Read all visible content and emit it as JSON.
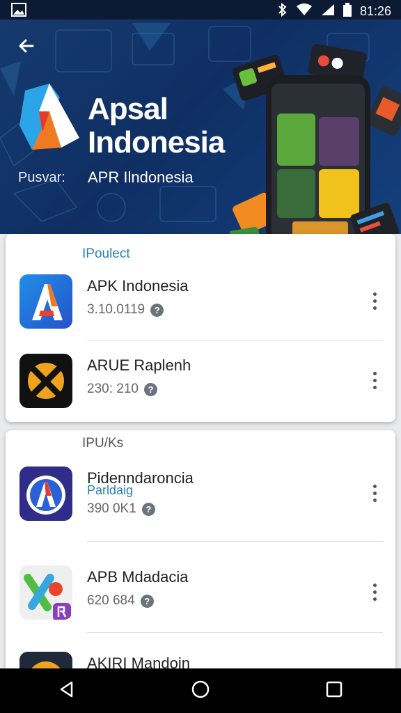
{
  "status_bar": {
    "time": "81:26",
    "icons": [
      "image-icon",
      "bluetooth-icon",
      "wifi-icon",
      "signal-icon",
      "battery-icon"
    ]
  },
  "header": {
    "brand_line1": "Apsal",
    "brand_line2": "Indonesia",
    "subtitle_label": "Pusvar:",
    "subtitle_value": "APR Ilndonesia",
    "back_icon": "back-arrow-icon"
  },
  "section1": {
    "label": "IPoulect",
    "items": [
      {
        "title": "APK Indonesia",
        "meta": "3.10.0119",
        "icon": "apk-a-logo-icon"
      },
      {
        "title": "ARUE Raplenh",
        "meta": "230: 210",
        "icon": "x-logo-icon"
      }
    ]
  },
  "section2": {
    "label": "IPU/Ks",
    "items": [
      {
        "title": "Pidenndaroncia",
        "sub": "Parldaig",
        "meta": "390 0K1",
        "icon": "circle-a-logo-icon"
      },
      {
        "title": "APB Mdadacia",
        "meta": "620 684",
        "icon": "xp-logo-icon"
      },
      {
        "title": "AKIRI Mandoin",
        "icon": "partial-logo-icon"
      }
    ]
  },
  "nav": {
    "back": "nav-back-icon",
    "home": "nav-home-icon",
    "recents": "nav-recents-icon"
  },
  "colors": {
    "status_bar": "#0d1a33",
    "banner": "#163a6e",
    "accent": "#2a7fb6"
  }
}
